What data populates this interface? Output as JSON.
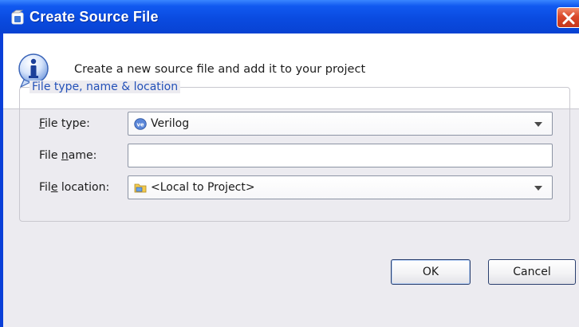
{
  "window": {
    "title": "Create Source File",
    "title_icon": "app-window-icon",
    "close_icon": "close-icon"
  },
  "header": {
    "icon": "info-icon",
    "message": "Create a new source file and add it to your project"
  },
  "group": {
    "legend": "File type, name & location",
    "file_type": {
      "label_pre": "",
      "label_mnemonic": "F",
      "label_post": "ile type:",
      "value": "Verilog",
      "icon": "verilog-icon"
    },
    "file_name": {
      "label_pre": "File ",
      "label_mnemonic": "n",
      "label_post": "ame:",
      "value": ""
    },
    "file_location": {
      "label_pre": "Fil",
      "label_mnemonic": "e",
      "label_post": " location:",
      "value": "<Local to Project>",
      "icon": "folder-icon"
    }
  },
  "buttons": {
    "ok": "OK",
    "cancel": "Cancel"
  },
  "colors": {
    "titlebar": "#0a4be0",
    "close": "#d9482a",
    "legend": "#2350b8",
    "dialog_bg": "#ecebf0"
  }
}
